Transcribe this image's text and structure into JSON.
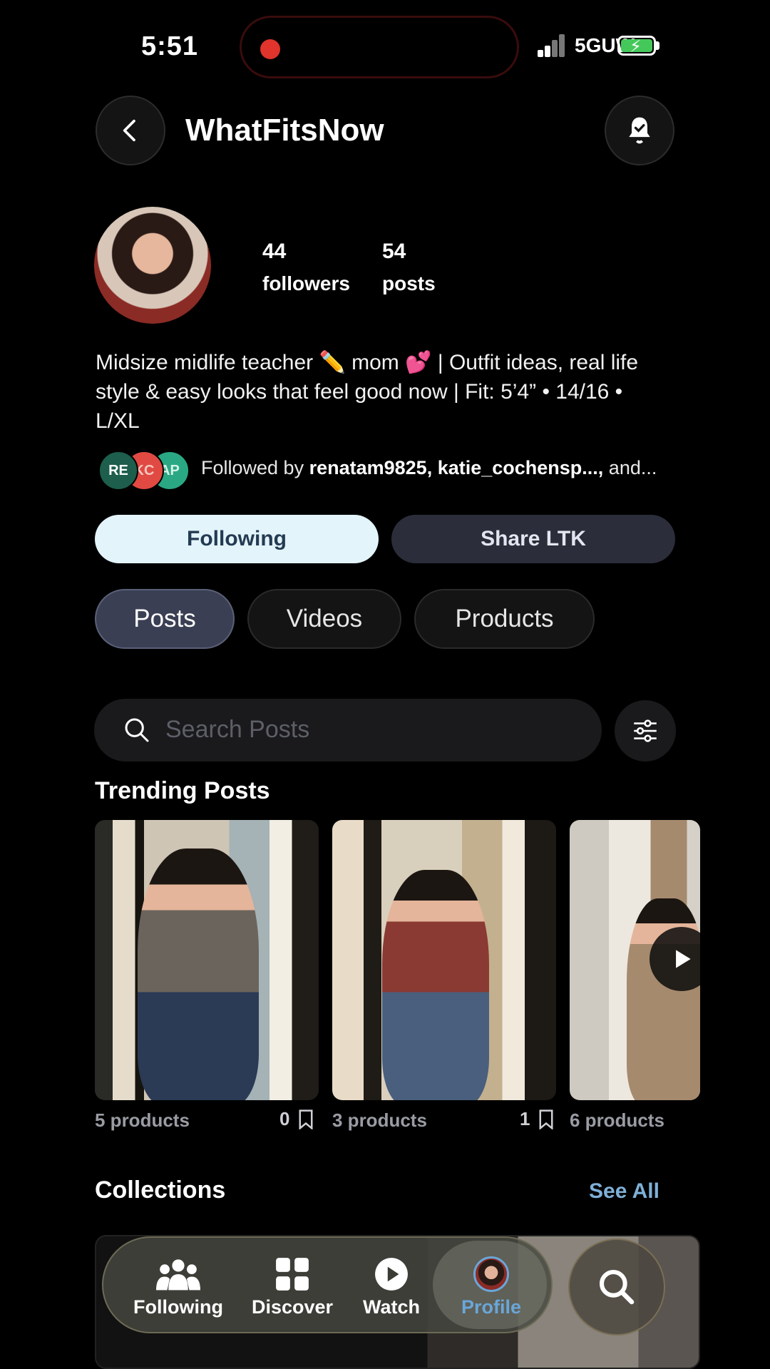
{
  "status_bar": {
    "time": "5:51",
    "network": "5GUW"
  },
  "header": {
    "title": "WhatFitsNow"
  },
  "profile": {
    "followers_count": "44",
    "followers_label": "followers",
    "posts_count": "54",
    "posts_label": "posts",
    "bio": "Midsize midlife teacher ✏️ mom 💕 | Outfit ideas, real life style & easy looks that feel good now | Fit: 5’4” • 14/16 • L/XL",
    "followed_by_prefix": "Followed by ",
    "followed_by_names": "renatam9825, katie_cochensp...,",
    "followed_by_suffix": " and...",
    "follower_chips": [
      {
        "initials": "RE",
        "color": "#1d5e4c"
      },
      {
        "initials": "KC",
        "color": "#e04a42"
      },
      {
        "initials": "AP",
        "color": "#2aa884"
      }
    ]
  },
  "actions": {
    "following_label": "Following",
    "share_label": "Share LTK"
  },
  "tabs": [
    {
      "label": "Posts",
      "active": true
    },
    {
      "label": "Videos",
      "active": false
    },
    {
      "label": "Products",
      "active": false
    }
  ],
  "search": {
    "placeholder": "Search Posts"
  },
  "trending": {
    "title": "Trending Posts",
    "posts": [
      {
        "products": "5 products",
        "saves": "0"
      },
      {
        "products": "3 products",
        "saves": "1"
      },
      {
        "products": "6 products",
        "saves": ""
      }
    ]
  },
  "collections": {
    "title": "Collections",
    "see_all": "See All"
  },
  "bottom_nav": [
    {
      "label": "Following",
      "icon": "people-icon"
    },
    {
      "label": "Discover",
      "icon": "grid-icon"
    },
    {
      "label": "Watch",
      "icon": "play-circle-icon"
    },
    {
      "label": "Profile",
      "icon": "avatar"
    }
  ],
  "colors": {
    "accent": "#6aa6d8",
    "following_button_bg": "#e3f4fb",
    "record_dot": "#e0342c",
    "battery": "#45c85a"
  }
}
